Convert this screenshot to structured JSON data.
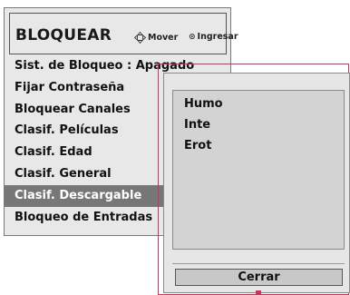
{
  "menu": {
    "title": "BLOQUEAR",
    "hint_move": "Mover",
    "hint_enter": "Ingresar",
    "items": [
      {
        "label": "Sist. de Bloqueo : Apagado"
      },
      {
        "label": "Fijar Contraseña"
      },
      {
        "label": "Bloquear Canales"
      },
      {
        "label": "Clasif. Películas"
      },
      {
        "label": "Clasif. Edad"
      },
      {
        "label": "Clasif. General"
      },
      {
        "label": "Clasif. Descargable",
        "selected": true
      },
      {
        "label": "Bloqueo de Entradas"
      }
    ]
  },
  "popup": {
    "items": [
      "Humo",
      "Inte",
      "Erot"
    ],
    "close_label": "Cerrar"
  },
  "colors": {
    "panel_bg": "#e8e8e8",
    "selected_bg": "#777777",
    "accent_border": "#c0395a"
  },
  "icons": {
    "move": "move-arrows-icon",
    "enter": "enter-icon"
  }
}
